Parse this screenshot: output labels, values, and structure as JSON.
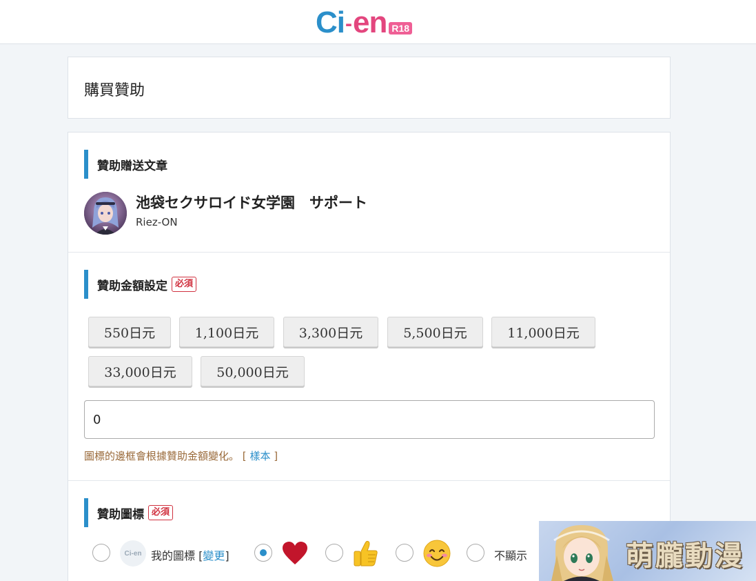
{
  "header": {
    "logo_ci": "Ci",
    "logo_dash": "-",
    "logo_en": "en",
    "logo_badge": "R18"
  },
  "page": {
    "title": "購買贊助"
  },
  "recipient": {
    "heading": "贊助贈送文章",
    "plan_name": "池袋セクサロイド女学園　サポート",
    "creator": "Riez-ON"
  },
  "amount": {
    "heading": "贊助金額設定",
    "required_label": "必須",
    "options": [
      "550日元",
      "1,100日元",
      "3,300日元",
      "5,500日元",
      "11,000日元",
      "33,000日元",
      "50,000日元"
    ],
    "input_value": "0",
    "hint_text": "圖標的邊框會根據贊助金額變化。",
    "hint_bracket_open": "[",
    "hint_link": "樣本",
    "hint_bracket_close": "]"
  },
  "icon": {
    "heading": "贊助圖標",
    "required_label": "必須",
    "avatar_mini_text": "Ci-en",
    "my_icon_label": "我的圖標",
    "change_open": "[",
    "change_link": "變更",
    "change_close": "]",
    "options": [
      "my-icon",
      "heart-icon",
      "thumbs-up-icon",
      "smile-icon",
      "none"
    ],
    "selected": "heart-icon",
    "hide_label": "不顯示"
  },
  "watermark": {
    "text": "萌朧動漫"
  },
  "colors": {
    "brand_blue": "#2b8fca",
    "brand_pink": "#e3467e",
    "required_red": "#d0313f",
    "hint_brown": "#9a6a3a"
  }
}
